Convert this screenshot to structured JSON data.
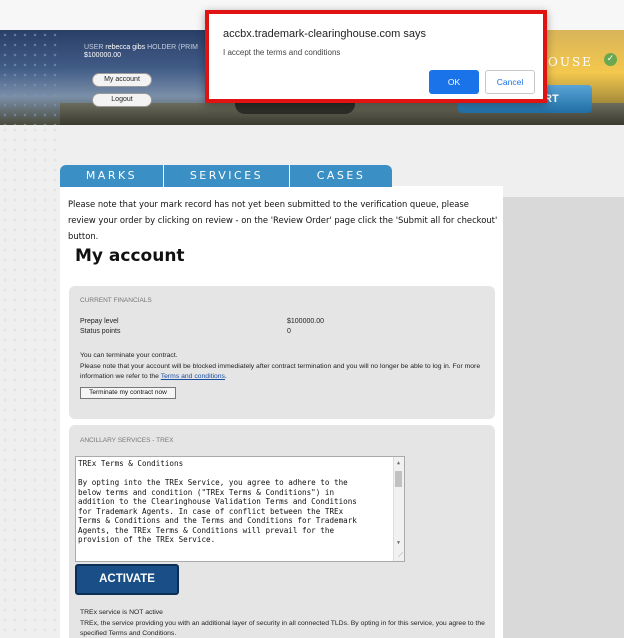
{
  "dialog": {
    "title": "accbx.trademark-clearinghouse.com says",
    "message": "I accept the terms and conditions",
    "ok_label": "OK",
    "cancel_label": "Cancel"
  },
  "header": {
    "user_label": "USER",
    "user_name": "rebecca gibs",
    "holder_label": "HOLDER (PRIM",
    "balance": "$100000.00",
    "my_account_label": "My account",
    "logout_label": "Logout",
    "brand_text": "OUSE",
    "start_label": "RT"
  },
  "tabs": [
    "MARKS",
    "SERVICES",
    "CASES"
  ],
  "notice": "Please note that your mark record has not yet been submitted to the verification queue, please review your order by clicking on review - on the 'Review Order' page click the 'Submit all for checkout' button.",
  "page_title": "My account",
  "financials": {
    "heading": "CURRENT FINANCIALS",
    "prepay_label": "Prepay level",
    "prepay_value": "$100000.00",
    "status_label": "Status points",
    "status_value": "0",
    "terminate_line1": "You can terminate your contract.",
    "terminate_line2a": "Please note that your account will be blocked immediately after contract termination and you will no longer be able to log in. For more information we refer to the ",
    "terms_link": "Terms and conditions",
    "terminate_line2b": ".",
    "terminate_button": "Terminate my contract now"
  },
  "ancillary": {
    "heading": "ANCILLARY SERVICES - TREX",
    "terms_title": "TREx Terms & Conditions",
    "terms_body": [
      "By opting into the TREx Service, you agree to adhere to the",
      "below terms and condition (\"TREx Terms & Conditions\") in",
      "addition to the Clearinghouse Validation Terms and Conditions",
      "for Trademark Agents. In case of conflict between the TREx",
      "Terms & Conditions and the Terms and Conditions for Trademark",
      "Agents, the TREx Terms & Conditions will prevail for the",
      "provision of the TREx Service."
    ],
    "activate_label": "ACTIVATE",
    "status_text": "TREx service is NOT active",
    "desc_text": "TREx, the service providing you with an additional layer of security in all connected TLDs. By opting in for this service, you agree to the specified Terms and Conditions."
  }
}
